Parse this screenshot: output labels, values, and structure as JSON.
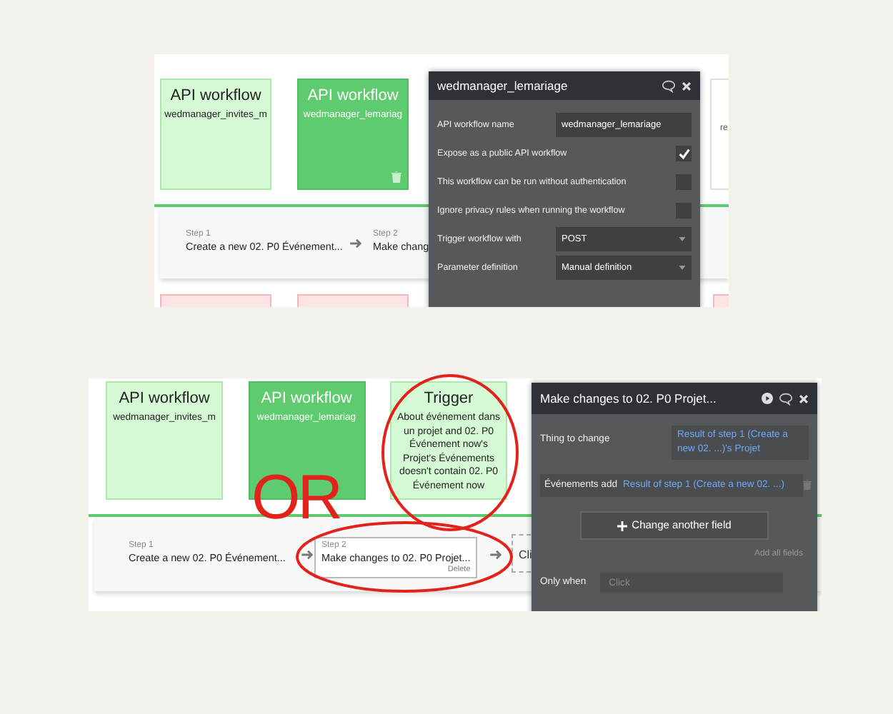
{
  "top_capture": {
    "cards": [
      {
        "kind": "api",
        "title": "API workflow",
        "subtitle": "wedmanager_invites_m",
        "selected": false
      },
      {
        "kind": "api",
        "title": "API workflow",
        "subtitle": "wedmanager_lemariag",
        "selected": true
      }
    ],
    "partial_card_text": "re",
    "steps": [
      {
        "label": "Step 1",
        "action": "Create a new 02. P0 Événement...",
        "selected": false
      },
      {
        "label": "Step 2",
        "action": "Make chang",
        "selected": false
      }
    ],
    "popup": {
      "title": "wedmanager_lemariage",
      "fields": [
        {
          "kind": "text",
          "label": "API workflow name",
          "value": "wedmanager_lemariage"
        },
        {
          "kind": "checkbox",
          "label": "Expose as a public API workflow",
          "checked": true
        },
        {
          "kind": "checkbox",
          "label": "This workflow can be run without authentication",
          "checked": false
        },
        {
          "kind": "checkbox",
          "label": "Ignore privacy rules when running the workflow",
          "checked": false
        },
        {
          "kind": "select",
          "label": "Trigger workflow with",
          "value": "POST"
        },
        {
          "kind": "select",
          "label": "Parameter definition",
          "value": "Manual definition"
        }
      ]
    }
  },
  "bottom_capture": {
    "cards": [
      {
        "kind": "api",
        "title": "API workflow",
        "subtitle": "wedmanager_invites_m",
        "selected": false
      },
      {
        "kind": "api",
        "title": "API workflow",
        "subtitle": "wedmanager_lemariag",
        "selected": true
      },
      {
        "kind": "trigger",
        "title": "Trigger",
        "subtitle": "About événement dans un projet and 02. P0 Événement now's Projet's Événements doesn't contain 02. P0 Événement now",
        "selected": false
      }
    ],
    "steps": [
      {
        "label": "Step 1",
        "action": "Create a new 02. P0 Événement...",
        "selected": false
      },
      {
        "label": "Step 2",
        "action": "Make changes to 02. P0 Projet...",
        "selected": true,
        "delete_label": "Delete"
      }
    ],
    "add_step": "Cli",
    "popup": {
      "title": "Make changes to 02. P0 Projet...",
      "fields": [
        {
          "kind": "thing",
          "label": "Thing to change",
          "value": "Result of step 1 (Create a new 02. ...)'s Projet"
        },
        {
          "kind": "field",
          "label": "Événements add",
          "value": "Result of step 1 (Create a new 02. ...)"
        }
      ],
      "add_button": "Change another field",
      "add_all": "Add all fields",
      "only_when": {
        "label": "Only when",
        "placeholder": "Click"
      }
    }
  },
  "annotation": {
    "text": "OR"
  }
}
